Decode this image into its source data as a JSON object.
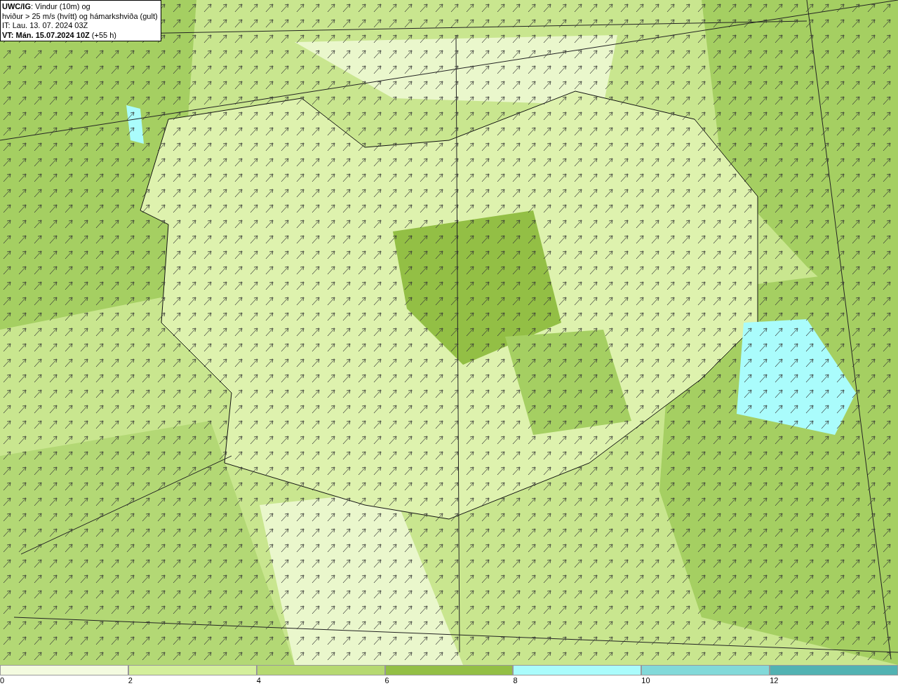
{
  "title_box": {
    "lines": [
      "**UWC/IG**: Vindur (10m) og",
      "hviður > 25 m/s (hvítt) og hámarkshviða (gult)",
      "IT: Lau. 13. 07. 2024 03Z",
      "**VT: Mán. 15.07.2024 10Z** (+55 h)"
    ]
  },
  "legend": [
    {
      "label": "0",
      "color": "#f4fbe0"
    },
    {
      "label": "2",
      "color": "#d4ef9c"
    },
    {
      "label": "4",
      "color": "#b6d971"
    },
    {
      "label": "6",
      "color": "#93bf45"
    },
    {
      "label": "8",
      "color": "#aafcfc"
    },
    {
      "label": "10",
      "color": "#82d9d9"
    },
    {
      "label": "12",
      "color": "#52b2b2"
    }
  ]
}
